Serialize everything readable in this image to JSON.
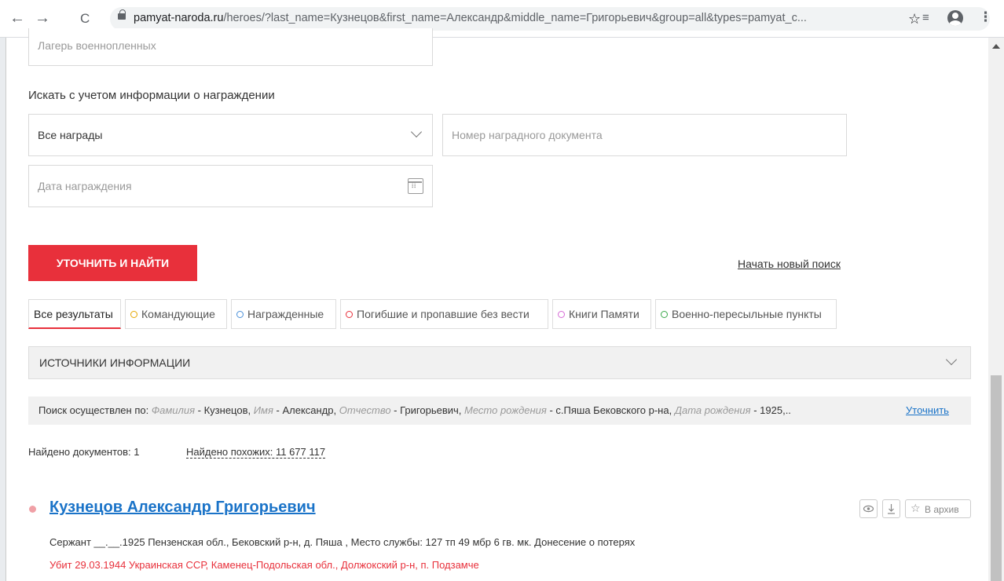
{
  "browser": {
    "url_host": "pamyat-naroda.ru",
    "url_path": "/heroes/?last_name=Кузнецов&first_name=Александр&middle_name=Григорьевич&group=all&types=pamyat_c...",
    "back": "←",
    "forward": "→",
    "reload": "C",
    "star": "☆",
    "queue": "≡",
    "menu": "⋮"
  },
  "form": {
    "camp_placeholder": "Лагерь военнопленных",
    "awards_label": "Искать с учетом информации о награждении",
    "awards_select": "Все награды",
    "award_doc_placeholder": "Номер наградного документа",
    "award_date_placeholder": "Дата награждения",
    "submit": "УТОЧНИТЬ И НАЙТИ",
    "new_search": "Начать новый поиск"
  },
  "tabs": [
    {
      "label": "Все результаты",
      "color": ""
    },
    {
      "label": "Командующие",
      "color": "#e6a700"
    },
    {
      "label": "Награжденные",
      "color": "#4a90d9"
    },
    {
      "label": "Погибшие и пропавшие без вести",
      "color": "#e8303b"
    },
    {
      "label": "Книги Памяти",
      "color": "#d66bd6"
    },
    {
      "label": "Военно-пересыльные пункты",
      "color": "#3aa84a"
    }
  ],
  "sources_label": "ИСТОЧНИКИ ИНФОРМАЦИИ",
  "search_info": {
    "prefix": "Поиск осуществлен по:",
    "k1": "Фамилия",
    "v1": "Кузнецов,",
    "k2": "Имя",
    "v2": "Александр,",
    "k3": "Отчество",
    "v3": "Григорьевич,",
    "k4": "Место рождения",
    "v4": "с.Пяша Бековского р-на,",
    "k5": "Дата рождения",
    "v5": "1925,..",
    "refine": "Уточнить"
  },
  "results": {
    "found": "Найдено документов: 1",
    "similar": "Найдено похожих: 11 677 117"
  },
  "hero": {
    "name": "Кузнецов Александр Григорьевич",
    "archive": "В архив",
    "line1": "Сержант __.__.1925 Пензенская обл., Бековский р-н, д. Пяша , Место службы: 127 тп 49 мбр 6 гв. мк. Донесение о потерях",
    "line2": "Убит 29.03.1944 Украинская ССР, Каменец-Подольская обл., Должокский р-н, п. Подзамче"
  },
  "colors": {
    "accent": "#e8303b",
    "link": "#1a73c8",
    "killed_text": "#e8303b"
  }
}
